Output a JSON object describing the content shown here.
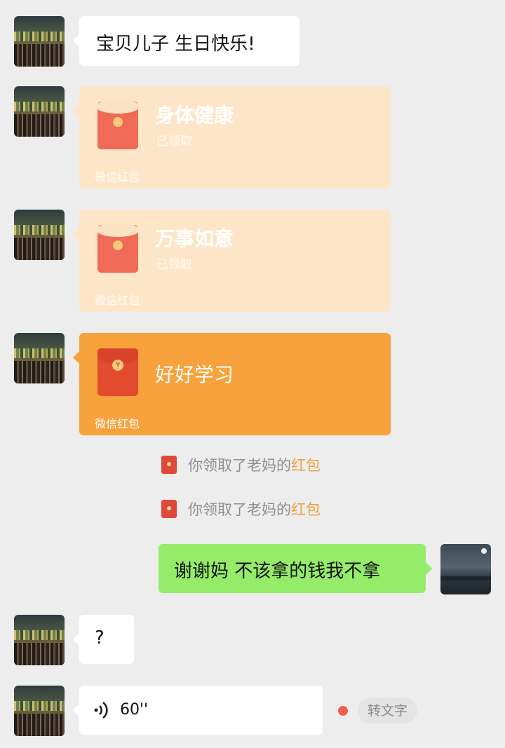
{
  "messages": {
    "m1_text": "宝贝儿子 生日快乐!",
    "rp1": {
      "title": "身体健康",
      "status": "已领取",
      "brand": "微信红包"
    },
    "rp2": {
      "title": "万事如意",
      "status": "已领取",
      "brand": "微信红包"
    },
    "rp3": {
      "title": "好好学习",
      "brand": "微信红包",
      "coin": "¥"
    },
    "sys1": {
      "prefix": "你领取了老妈的",
      "link": "红包"
    },
    "sys2": {
      "prefix": "你领取了老妈的",
      "link": "红包"
    },
    "reply_text": "谢谢妈 不该拿的钱我不拿",
    "question_text": "?",
    "voice": {
      "duration": "60''",
      "to_text_label": "转文字"
    }
  },
  "colors": {
    "background": "#ededed",
    "incoming_bubble": "#ffffff",
    "outgoing_bubble": "#95ec69",
    "red_packet_opened": "#fde6c8",
    "red_packet_new": "#f7a23c",
    "link_orange": "#e6a23c",
    "unread_dot": "#f25d4e"
  },
  "icons": [
    "red-packet-icon",
    "voice-wave-icon",
    "unread-dot-icon",
    "mini-red-packet-icon"
  ]
}
